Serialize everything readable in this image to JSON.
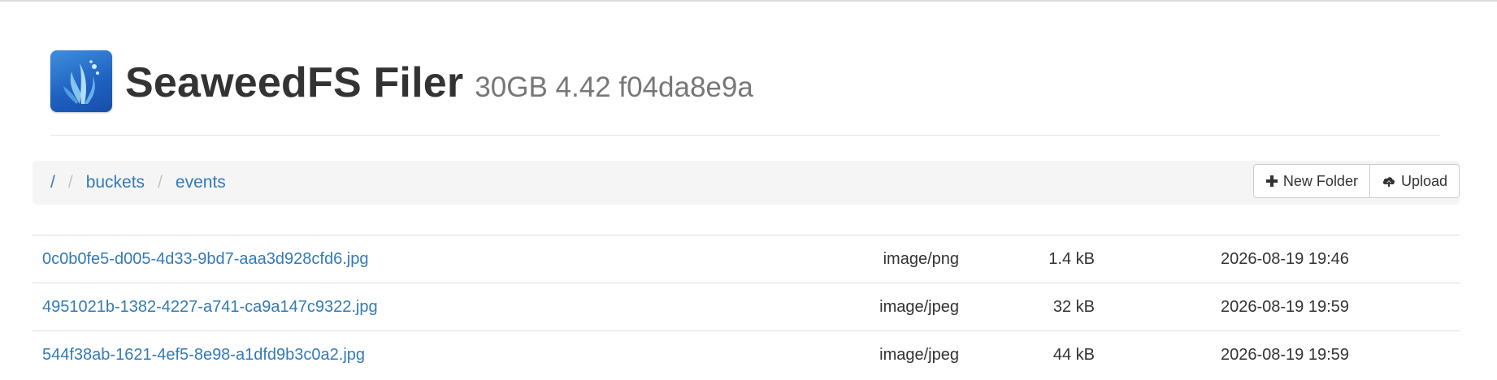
{
  "header": {
    "title": "SeaweedFS Filer",
    "subtitle": "30GB 4.42 f04da8e9a"
  },
  "breadcrumb": {
    "root": "/",
    "items": [
      "buckets",
      "events"
    ],
    "separator": "/"
  },
  "actions": {
    "new_folder_label": "New Folder",
    "upload_label": "Upload"
  },
  "files": [
    {
      "name": "0c0b0fe5-d005-4d33-9bd7-aaa3d928cfd6.jpg",
      "type": "image/png",
      "size": "1.4 kB",
      "modified": "2026-08-19 19:46"
    },
    {
      "name": "4951021b-1382-4227-a741-ca9a147c9322.jpg",
      "type": "image/jpeg",
      "size": "32 kB",
      "modified": "2026-08-19 19:59"
    },
    {
      "name": "544f38ab-1621-4ef5-8e98-a1dfd9b3c0a2.jpg",
      "type": "image/jpeg",
      "size": "44 kB",
      "modified": "2026-08-19 19:59"
    }
  ],
  "colors": {
    "link": "#337ab7",
    "bar_background": "#f5f5f5",
    "logo_blue": "#2563c9"
  },
  "icons": {
    "logo": "seaweed-logo",
    "new_folder": "plus-icon",
    "upload": "cloud-upload-icon"
  }
}
